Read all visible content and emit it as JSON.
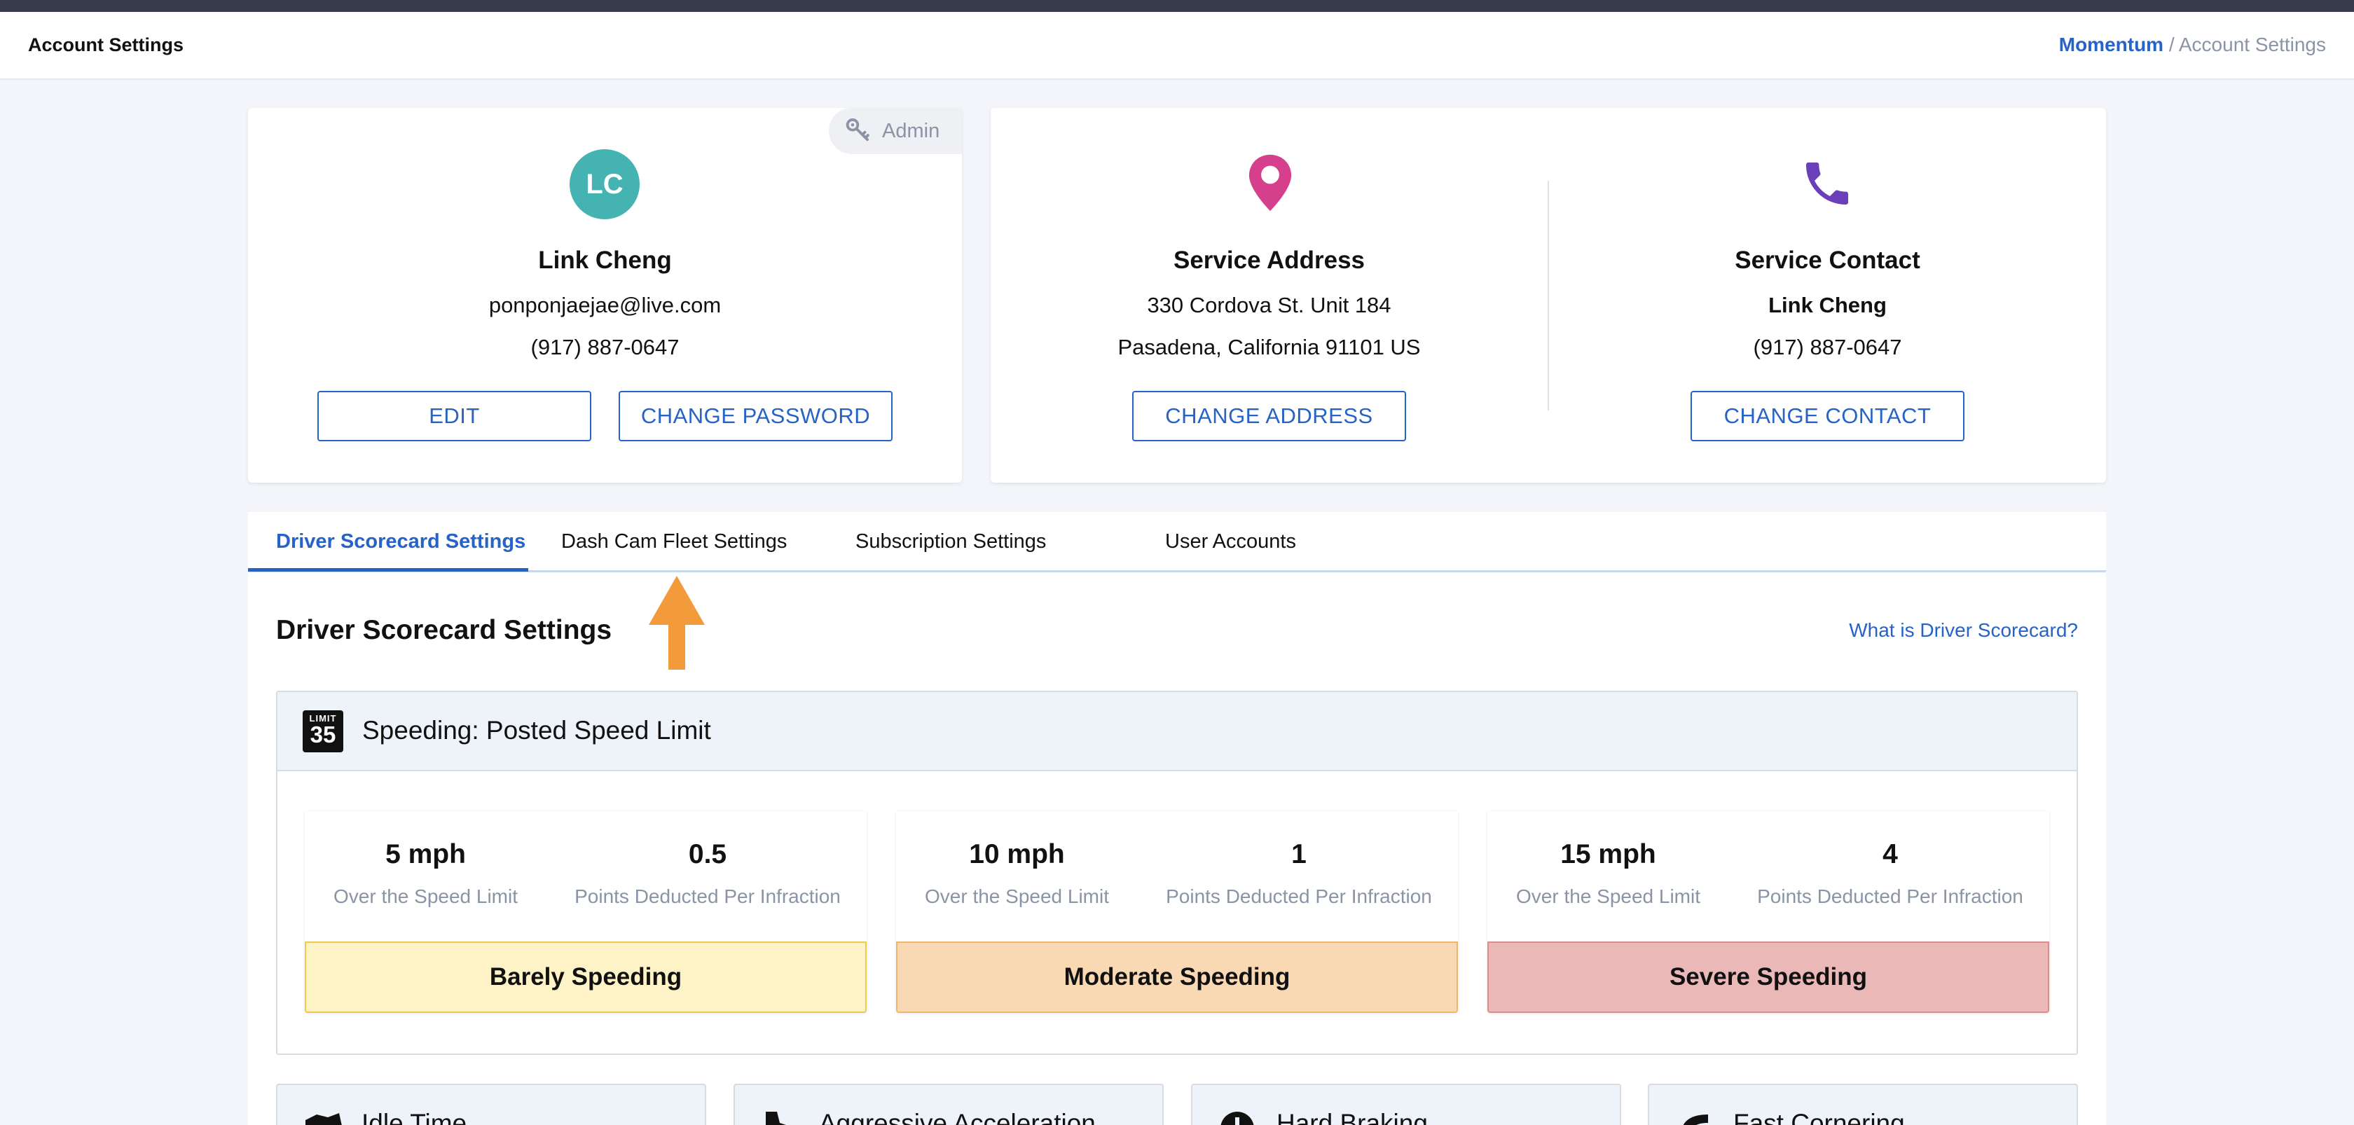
{
  "header": {
    "title": "Account Settings",
    "breadcrumb": {
      "brand": "Momentum",
      "separator": " / ",
      "current": "Account Settings"
    }
  },
  "profile_card": {
    "badge_label": "Admin",
    "initials": "LC",
    "name": "Link Cheng",
    "email": "ponponjaejae@live.com",
    "phone": "(917) 887-0647",
    "edit_label": "EDIT",
    "change_password_label": "CHANGE PASSWORD",
    "colors": {
      "avatar": "#45b3b1"
    }
  },
  "service_address": {
    "icon": "location-pin-icon",
    "title": "Service Address",
    "line1": "330 Cordova St. Unit 184",
    "line2": "Pasadena, California 91101 US",
    "button_label": "CHANGE ADDRESS",
    "colors": {
      "icon": "#d63f8c"
    }
  },
  "service_contact": {
    "icon": "phone-icon",
    "title": "Service Contact",
    "name": "Link Cheng",
    "phone": "(917) 887-0647",
    "button_label": "CHANGE CONTACT",
    "colors": {
      "icon": "#6b3fb8"
    }
  },
  "tabs": [
    {
      "label": "Driver Scorecard Settings",
      "active": true
    },
    {
      "label": "Dash Cam Fleet Settings",
      "active": false
    },
    {
      "label": "Subscription Settings",
      "active": false
    },
    {
      "label": "User Accounts",
      "active": false
    }
  ],
  "scorecard": {
    "title": "Driver Scorecard Settings",
    "help_link": "What is Driver Scorecard?",
    "speeding": {
      "sign_top": "LIMIT",
      "sign_number": "35",
      "title": "Speeding: Posted Speed Limit",
      "tiers": [
        {
          "speed": "5 mph",
          "speed_label": "Over the Speed Limit",
          "points": "0.5",
          "points_label": "Points Deducted Per Infraction",
          "name": "Barely Speeding",
          "color": "#fef3c7",
          "border": "#efc94c"
        },
        {
          "speed": "10 mph",
          "speed_label": "Over the Speed Limit",
          "points": "1",
          "points_label": "Points Deducted Per Infraction",
          "name": "Moderate Speeding",
          "color": "#f9d9b4",
          "border": "#f0b56a"
        },
        {
          "speed": "15 mph",
          "speed_label": "Over the Speed Limit",
          "points": "4",
          "points_label": "Points Deducted Per Infraction",
          "name": "Severe Speeding",
          "color": "#ebb8b8",
          "border": "#dc8a8a"
        }
      ]
    },
    "categories": [
      {
        "label": "Idle Time",
        "icon": "idle-icon"
      },
      {
        "label": "Aggressive Acceleration",
        "icon": "acceleration-icon"
      },
      {
        "label": "Hard Braking",
        "icon": "braking-icon"
      },
      {
        "label": "Fast Cornering",
        "icon": "cornering-icon"
      }
    ]
  },
  "colors": {
    "accent": "#2563c9",
    "annotation_arrow": "#f39a3a"
  }
}
